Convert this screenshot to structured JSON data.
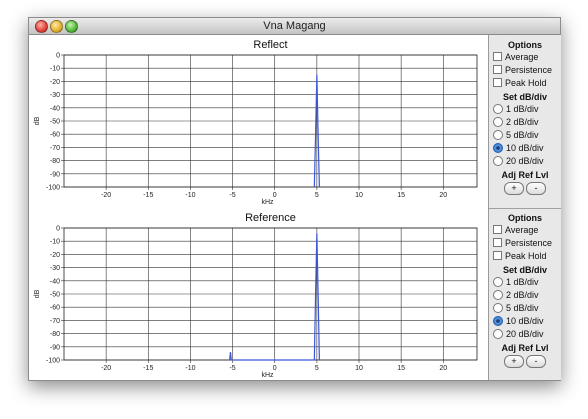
{
  "window": {
    "title": "Vna Magang"
  },
  "chart_data": [
    {
      "type": "line",
      "title": "Reflect",
      "xlabel": "kHz",
      "ylabel": "dB",
      "xlim": [
        -25,
        24
      ],
      "ylim": [
        -100,
        0
      ],
      "x_ticks": [
        -20,
        -15,
        -10,
        -5,
        0,
        5,
        10,
        15,
        20
      ],
      "x_tick_labels": [
        "-20",
        "-15",
        "-10",
        "-5",
        "0",
        "5",
        "10",
        "15",
        "20"
      ],
      "y_ticks": [
        0,
        -10,
        -20,
        -30,
        -40,
        -50,
        -60,
        -70,
        -80,
        -90,
        -100
      ],
      "y_tick_labels": [
        "0",
        "-10",
        "-20",
        "-30",
        "-40",
        "-50",
        "-60",
        "-70",
        "-80",
        "-90",
        "-100"
      ],
      "grid": true,
      "series": [
        {
          "color": "#3b57d6",
          "x": [
            4.7,
            4.85,
            5.0,
            5.15,
            5.3
          ],
          "y": [
            -100,
            -60,
            -15,
            -60,
            -100
          ]
        }
      ]
    },
    {
      "type": "line",
      "title": "Reference",
      "xlabel": "kHz",
      "ylabel": "dB",
      "xlim": [
        -25,
        24
      ],
      "ylim": [
        -100,
        0
      ],
      "x_ticks": [
        -20,
        -15,
        -10,
        -5,
        0,
        5,
        10,
        15,
        20
      ],
      "x_tick_labels": [
        "-20",
        "-15",
        "-10",
        "-5",
        "0",
        "5",
        "10",
        "15",
        "20"
      ],
      "y_ticks": [
        0,
        -10,
        -20,
        -30,
        -40,
        -50,
        -60,
        -70,
        -80,
        -90,
        -100
      ],
      "y_tick_labels": [
        "0",
        "-10",
        "-20",
        "-30",
        "-40",
        "-50",
        "-60",
        "-70",
        "-80",
        "-90",
        "-100"
      ],
      "grid": true,
      "series": [
        {
          "color": "#3b57d6",
          "x": [
            -5.35,
            -5.25,
            -5.15,
            4.7,
            4.85,
            5.0,
            5.15,
            5.3
          ],
          "y": [
            -100,
            -94,
            -100,
            -100,
            -50,
            -4,
            -50,
            -100
          ]
        }
      ]
    }
  ],
  "options": [
    {
      "title": "Options",
      "checkboxes": [
        "Average",
        "Persistence",
        "Peak Hold"
      ],
      "set_title": "Set dB/div",
      "radios": [
        "1 dB/div",
        "2 dB/div",
        "5 dB/div",
        "10 dB/div",
        "20 dB/div"
      ],
      "selected": 3,
      "adj_title": "Adj Ref Lvl",
      "plus": "+",
      "minus": "-"
    },
    {
      "title": "Options",
      "checkboxes": [
        "Average",
        "Persistence",
        "Peak Hold"
      ],
      "set_title": "Set dB/div",
      "radios": [
        "1 dB/div",
        "2 dB/div",
        "5 dB/div",
        "10 dB/div",
        "20 dB/div"
      ],
      "selected": 3,
      "adj_title": "Adj Ref Lvl",
      "plus": "+",
      "minus": "-"
    }
  ]
}
